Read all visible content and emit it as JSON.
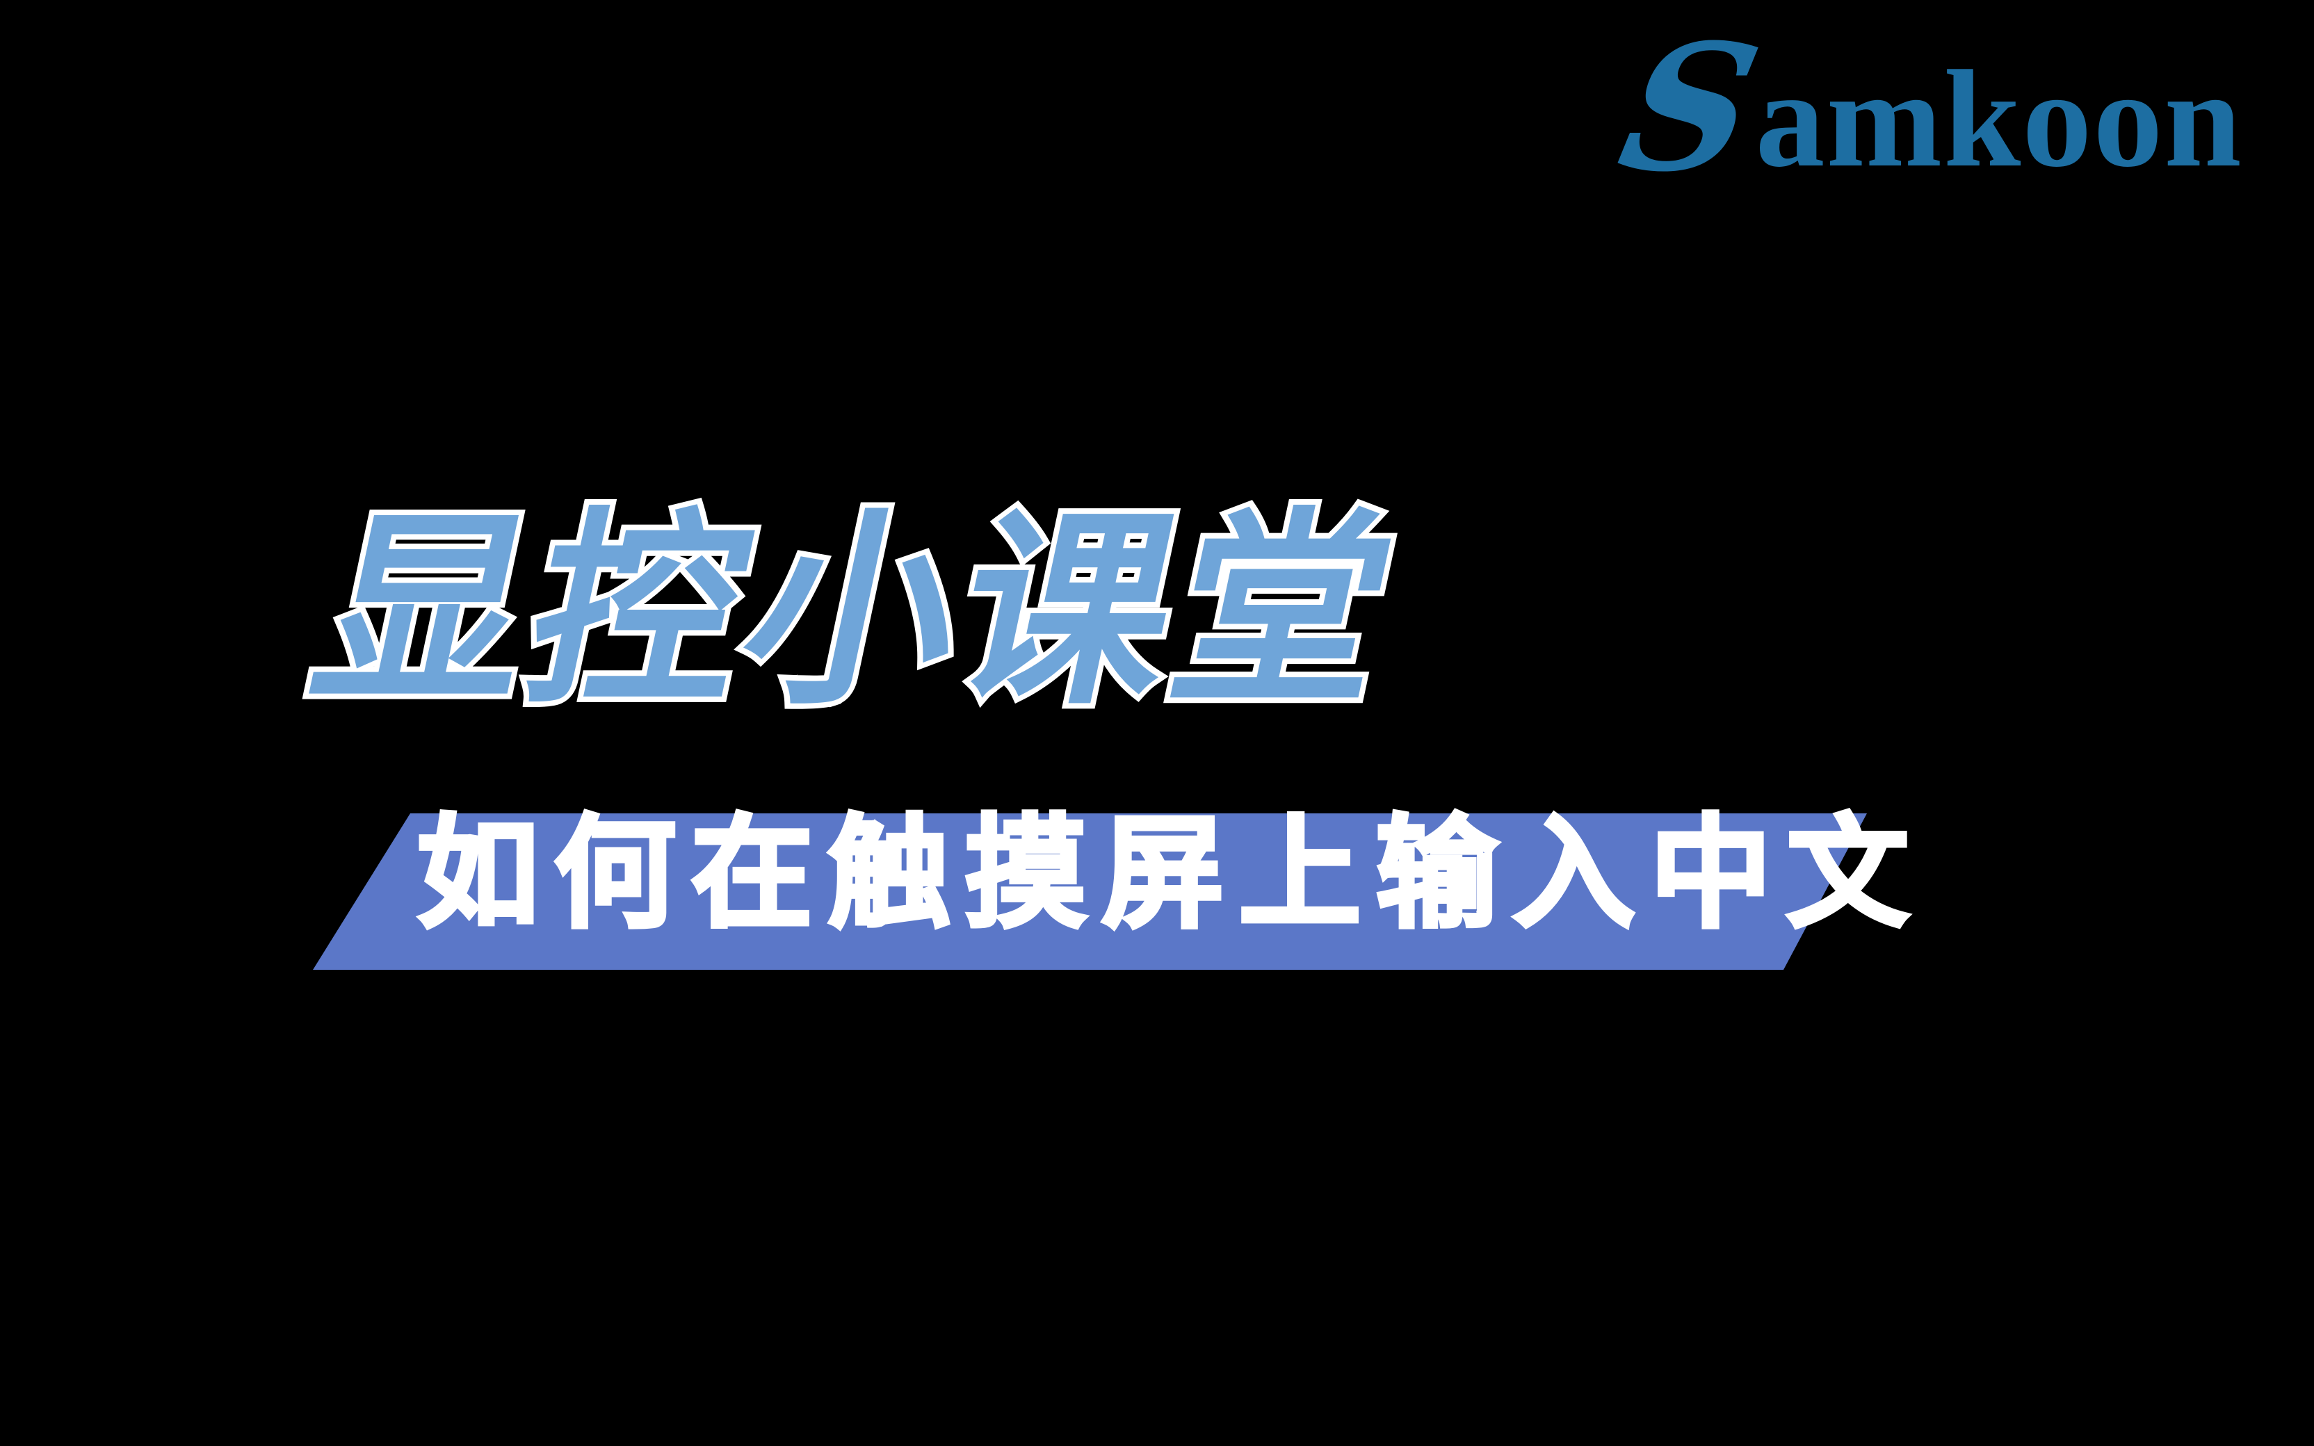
{
  "brand": {
    "name": "Samkoon",
    "initial": "S",
    "rest": "amkoon",
    "color": "#1d6ea2"
  },
  "title": {
    "text": "显控小课堂",
    "fill_color": "#6fa5d9",
    "outline_color": "#ffffff"
  },
  "subtitle": {
    "text": "如何在触摸屏上输入中文",
    "text_color": "#ffffff",
    "ribbon_color": "#5b77c8"
  },
  "background_color": "#000000"
}
